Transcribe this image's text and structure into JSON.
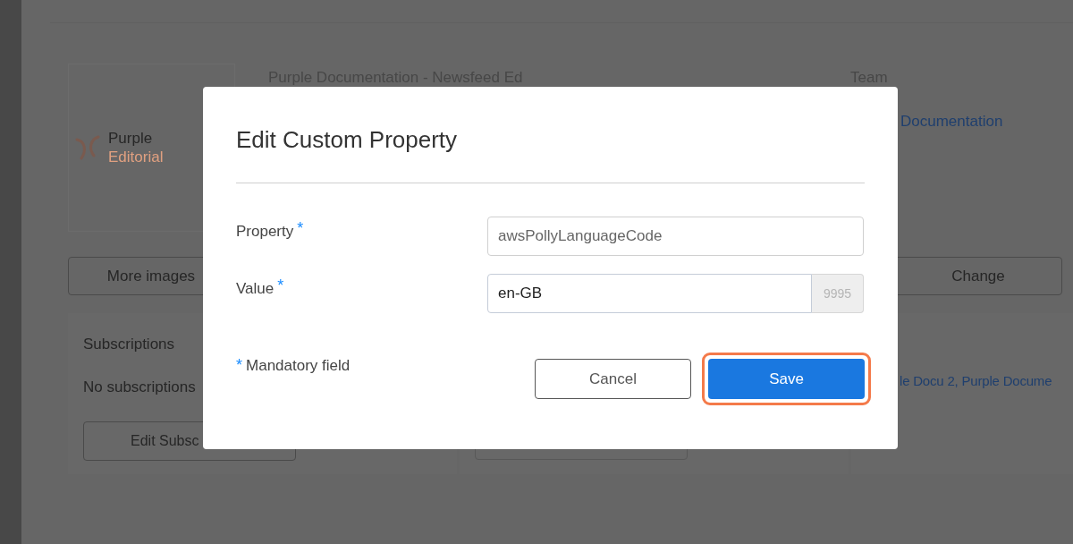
{
  "background": {
    "logo": {
      "line1": "Purple",
      "line2": "Editorial"
    },
    "title": "Purple Documentation - Newsfeed Ed",
    "team_label": "Team",
    "team_link": "Documentation",
    "more_images_button": "More images",
    "change_button": "Change",
    "subscriptions": {
      "heading": "Subscriptions",
      "empty": "No subscriptions",
      "button": "Edit Subsc"
    },
    "links": "le Docu 2, Purple Docume"
  },
  "dialog": {
    "title": "Edit Custom Property",
    "fields": [
      {
        "label": "Property",
        "mark": "*",
        "value": "awsPollyLanguageCode",
        "readonly": true
      },
      {
        "label": "Value",
        "mark": "*",
        "value": "en-GB",
        "readonly": false,
        "counter": "9995"
      }
    ],
    "note": {
      "mark": "*",
      "text": "Mandatory field"
    },
    "buttons": [
      {
        "label": "Cancel",
        "kind": "secondary",
        "highlighted": false
      },
      {
        "label": "Save",
        "kind": "primary",
        "highlighted": true
      }
    ]
  }
}
